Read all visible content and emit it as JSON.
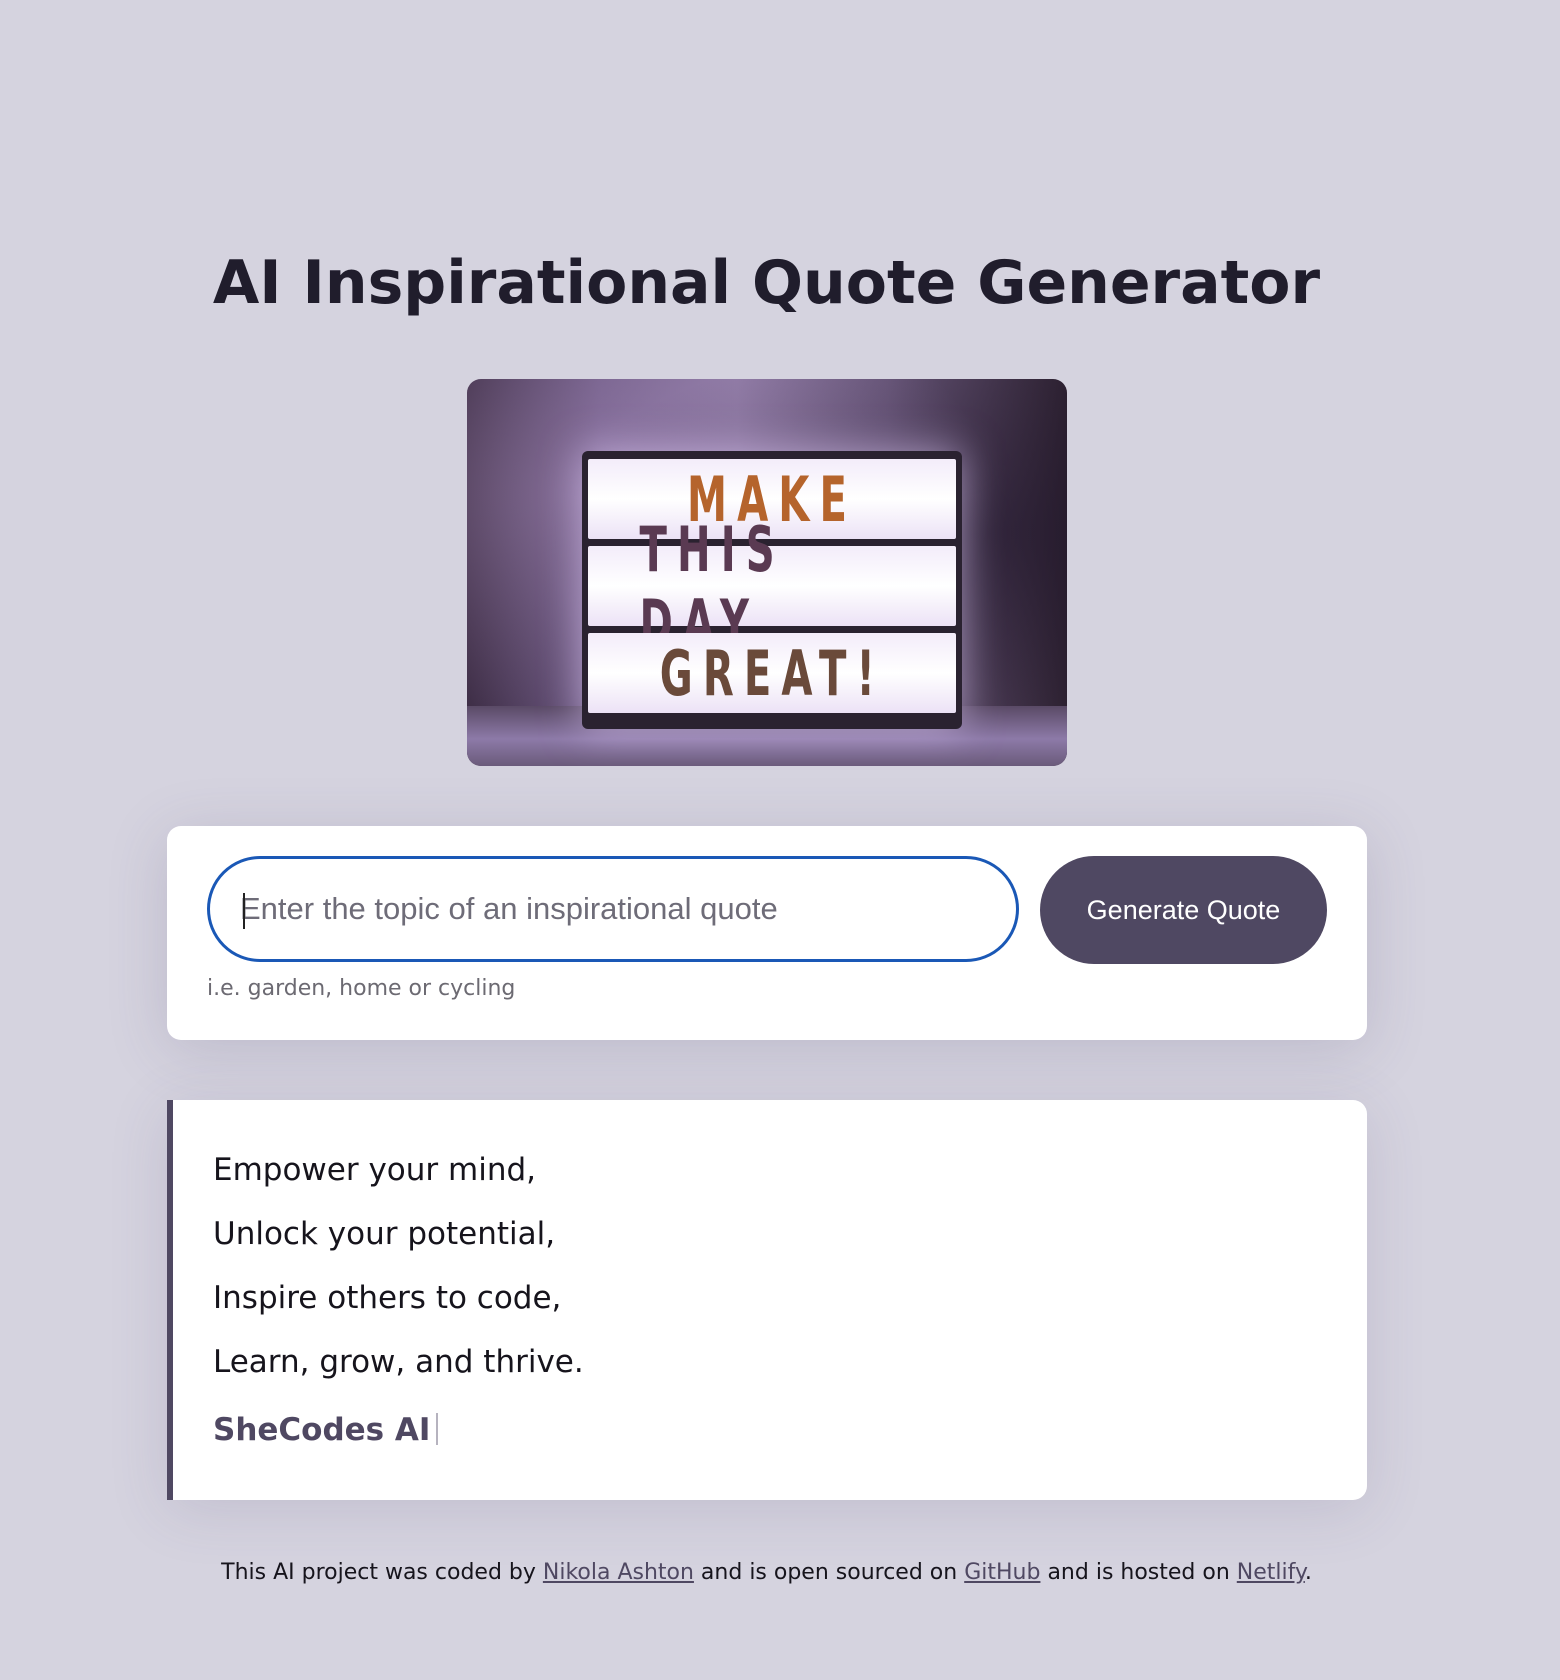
{
  "page": {
    "title": "AI Inspirational Quote Generator"
  },
  "hero": {
    "lines": [
      "MAKE",
      "THIS DAY",
      "GREAT!"
    ]
  },
  "form": {
    "input_placeholder": "Enter the topic of an inspirational quote",
    "input_value": "",
    "button_label": "Generate Quote",
    "hint": "i.e. garden, home or cycling"
  },
  "quote": {
    "lines": [
      "Empower your mind,",
      "Unlock your potential,",
      "Inspire others to code,",
      "Learn, grow, and thrive."
    ],
    "signature": "SheCodes AI"
  },
  "footer": {
    "text_1": "This AI project was coded by ",
    "author_link": "Nikola Ashton",
    "text_2": " and is open sourced on ",
    "github_link": "GitHub",
    "text_3": " and is hosted on ",
    "netlify_link": "Netlify",
    "text_4": "."
  },
  "colors": {
    "background": "#d5d3df",
    "accent": "#4f4862",
    "input_focus_border": "#1a58b6",
    "title": "#201d2c"
  }
}
